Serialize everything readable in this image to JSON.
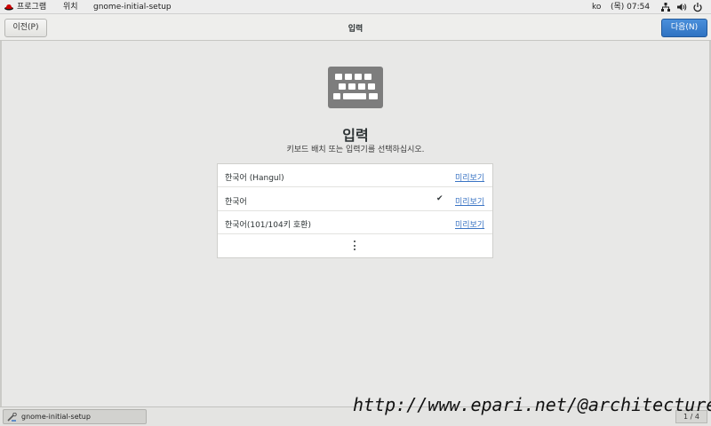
{
  "top_panel": {
    "menu_programs": "프로그램",
    "menu_places": "위치",
    "app_name": "gnome-initial-setup",
    "lang": "ko",
    "clock": "(목) 07:54"
  },
  "header": {
    "prev_label": "이전(P)",
    "title": "입력",
    "next_label": "다음(N)"
  },
  "main": {
    "icon": "keyboard-icon",
    "title": "입력",
    "subtitle": "키보드 배치 또는 입력기를 선택하십시오."
  },
  "input_sources": [
    {
      "name": "한국어 (Hangul)",
      "checked": "",
      "preview": "미리보기"
    },
    {
      "name": "한국어",
      "checked": "✔",
      "preview": "미리보기"
    },
    {
      "name": "한국어(101/104키 호환)",
      "checked": "",
      "preview": "미리보기"
    }
  ],
  "taskbar": {
    "task_label": "gnome-initial-setup",
    "pager": "1 / 4"
  },
  "watermark": "http://www.epari.net/@architecture",
  "colors": {
    "accent": "#3a74c4",
    "next_button": "#3a80d2",
    "background": "#e8e8e7"
  }
}
